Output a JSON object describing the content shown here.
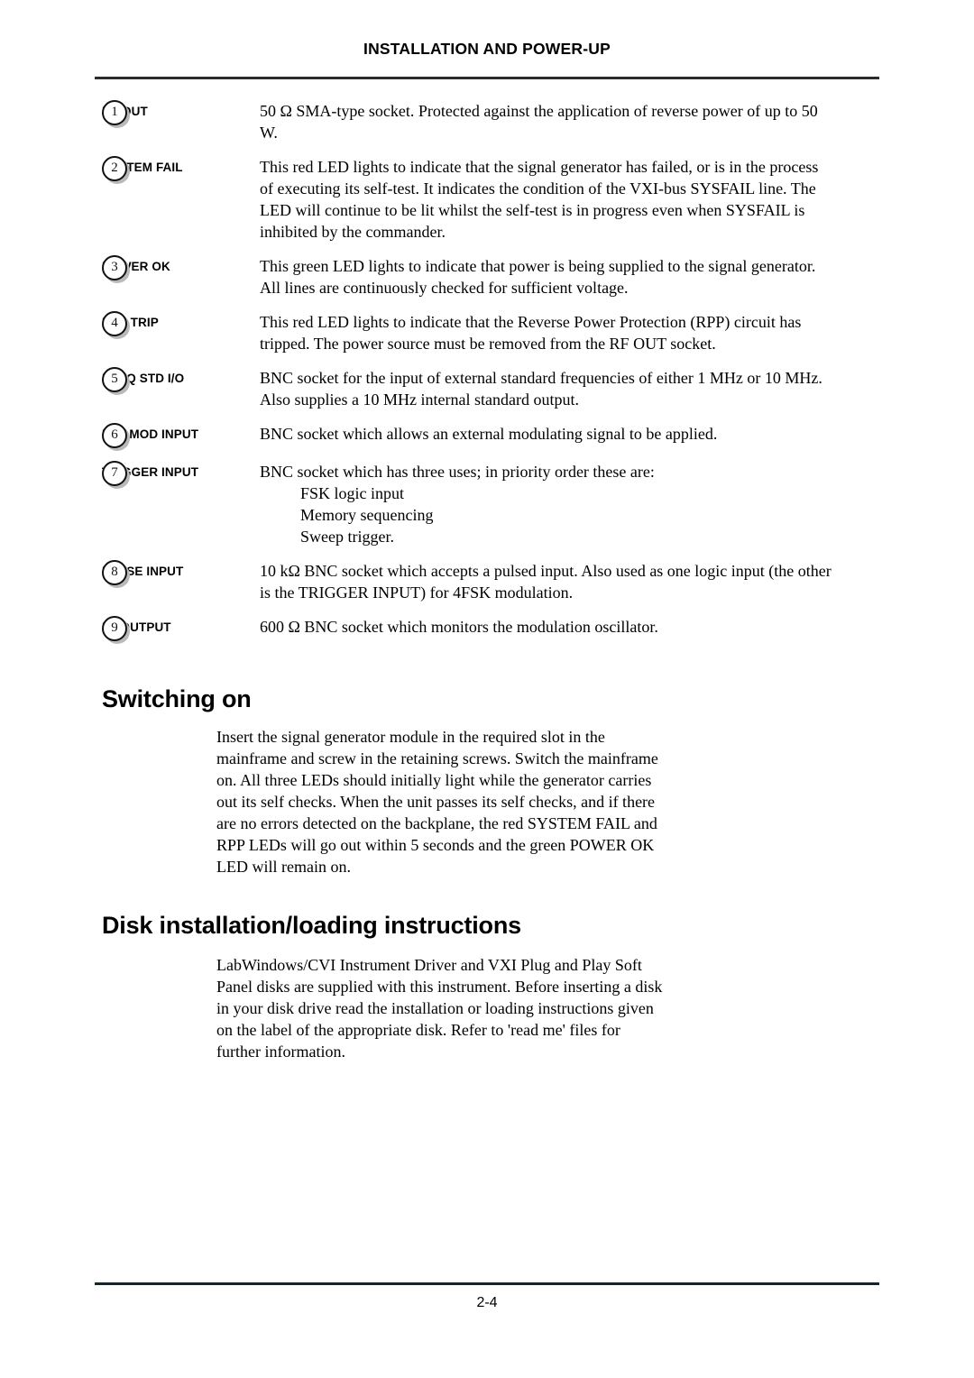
{
  "header": {
    "title": "INSTALLATION AND POWER-UP"
  },
  "footer": {
    "page_number": "2-4"
  },
  "callouts": [
    {
      "number": "1",
      "label": "RF OUT",
      "description": "50 Ω SMA-type socket.  Protected against the application of reverse power of up to 50 W."
    },
    {
      "number": "2",
      "label": "SYSTEM FAIL",
      "description": "This red LED lights to indicate that the signal generator has failed, or is in the process of executing its self-test.  It indicates the condition of the VXI-bus SYSFAIL line.  The LED will continue to be lit whilst the self-test is in progress even when SYSFAIL is inhibited by the commander."
    },
    {
      "number": "3",
      "label": "POWER OK",
      "description": "This green LED lights to indicate that power is being supplied to the signal generator.  All lines are continuously checked for sufficient voltage."
    },
    {
      "number": "4",
      "label": "RPP TRIP",
      "description": "This red LED lights to indicate that the Reverse Power Protection (RPP) circuit has tripped.  The power source must be removed from the RF OUT socket."
    },
    {
      "number": "5",
      "label": "FREQ STD I/O",
      "description": "BNC socket for the input of external standard frequencies of either 1 MHz or 10 MHz.  Also supplies a 10 MHz internal standard output."
    },
    {
      "number": "6",
      "label": "EXT MOD INPUT",
      "description": "BNC socket which allows an external modulating signal to be applied."
    },
    {
      "number": "7",
      "label": "TRIGGER INPUT",
      "description": "BNC socket which has three uses; in priority order these are:",
      "sub_items": [
        "FSK logic input",
        "Memory sequencing",
        "Sweep trigger."
      ]
    },
    {
      "number": "8",
      "label": "PULSE INPUT",
      "description": "10 kΩ BNC socket which accepts a pulsed input.  Also used as one logic input (the other is the TRIGGER INPUT) for 4FSK modulation."
    },
    {
      "number": "9",
      "label": "LF OUTPUT",
      "description": "600 Ω BNC socket which monitors the modulation oscillator."
    }
  ],
  "sections": [
    {
      "heading": "Switching on",
      "paragraph": "Insert the signal generator module in the required slot in the mainframe and screw in the retaining screws.  Switch the mainframe on.  All three LEDs should initially light while the generator carries out its self checks.  When the unit passes its self checks, and if there are no errors detected on the backplane, the red SYSTEM FAIL and RPP LEDs will go out within 5 seconds and the green POWER OK LED will remain on."
    },
    {
      "heading": "Disk installation/loading instructions",
      "paragraph": "LabWindows/CVI Instrument Driver and VXI Plug and Play Soft Panel disks are supplied with this instrument.  Before inserting a disk in your disk drive read the installation or loading instructions given on the label of the appropriate disk.  Refer to 'read me' files for further information."
    }
  ]
}
